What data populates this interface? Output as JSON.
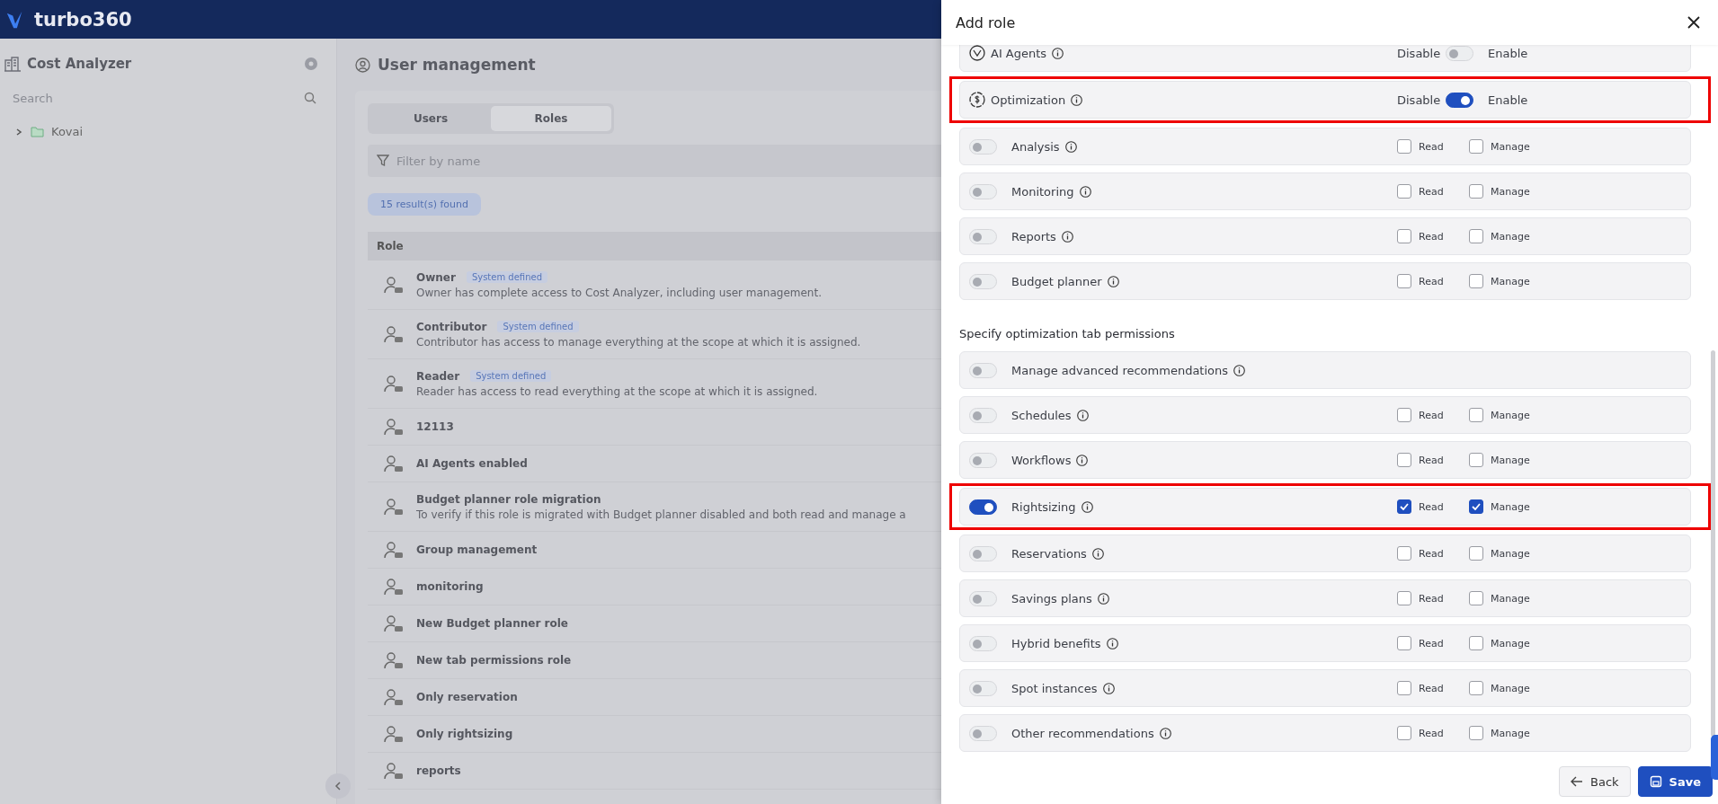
{
  "app": {
    "name": "turbo360"
  },
  "sidebar": {
    "title": "Cost Analyzer",
    "search": {
      "placeholder": "Search"
    },
    "tree": [
      {
        "label": "Kovai",
        "expanded": false
      }
    ]
  },
  "main": {
    "title": "User management",
    "tabs": [
      {
        "label": "Users",
        "selected": false
      },
      {
        "label": "Roles",
        "selected": true
      }
    ],
    "filter": {
      "placeholder": "Filter by name"
    },
    "result_count": "15 result(s) found",
    "table": {
      "columns": [
        "Role"
      ],
      "rows": [
        {
          "name": "Owner",
          "badge": "System defined",
          "description": "Owner has complete access to Cost Analyzer, including user management."
        },
        {
          "name": "Contributor",
          "badge": "System defined",
          "description": "Contributor has access to manage everything at the scope at which it is assigned."
        },
        {
          "name": "Reader",
          "badge": "System defined",
          "description": "Reader has access to read everything at the scope at which it is assigned."
        },
        {
          "name": "12113"
        },
        {
          "name": "AI Agents enabled"
        },
        {
          "name": "Budget planner role migration",
          "description": "To verify if this role is migrated with Budget planner disabled and both read and manage a"
        },
        {
          "name": "Group management"
        },
        {
          "name": "monitoring"
        },
        {
          "name": "New Budget planner role"
        },
        {
          "name": "New tab permissions role"
        },
        {
          "name": "Only reservation"
        },
        {
          "name": "Only rightsizing"
        },
        {
          "name": "reports"
        }
      ]
    }
  },
  "drawer": {
    "title": "Add role",
    "rows": [
      {
        "kind": "feature",
        "label": "AI Agents",
        "off_label": "Disable",
        "on_label": "Enable",
        "on": false,
        "highlighted": false
      },
      {
        "kind": "feature",
        "label": "Optimization",
        "off_label": "Disable",
        "on_label": "Enable",
        "on": true,
        "highlighted": true
      },
      {
        "kind": "permission",
        "label": "Analysis",
        "on": false,
        "read": {
          "label": "Read",
          "checked": false
        },
        "manage": {
          "label": "Manage",
          "checked": false
        },
        "highlighted": false
      },
      {
        "kind": "permission",
        "label": "Monitoring",
        "on": false,
        "read": {
          "label": "Read",
          "checked": false
        },
        "manage": {
          "label": "Manage",
          "checked": false
        },
        "highlighted": false
      },
      {
        "kind": "permission",
        "label": "Reports",
        "on": false,
        "read": {
          "label": "Read",
          "checked": false
        },
        "manage": {
          "label": "Manage",
          "checked": false
        },
        "highlighted": false
      },
      {
        "kind": "permission",
        "label": "Budget planner",
        "on": false,
        "read": {
          "label": "Read",
          "checked": false
        },
        "manage": {
          "label": "Manage",
          "checked": false
        },
        "highlighted": false
      }
    ],
    "section_title": "Specify optimization tab permissions",
    "tab_rows": [
      {
        "kind": "permission",
        "label": "Manage advanced recommendations",
        "on": false,
        "highlighted": false
      },
      {
        "kind": "permission",
        "label": "Schedules",
        "on": false,
        "read": {
          "label": "Read",
          "checked": false
        },
        "manage": {
          "label": "Manage",
          "checked": false
        },
        "highlighted": false
      },
      {
        "kind": "permission",
        "label": "Workflows",
        "on": false,
        "read": {
          "label": "Read",
          "checked": false
        },
        "manage": {
          "label": "Manage",
          "checked": false
        },
        "highlighted": false
      },
      {
        "kind": "permission",
        "label": "Rightsizing",
        "on": true,
        "read": {
          "label": "Read",
          "checked": true
        },
        "manage": {
          "label": "Manage",
          "checked": true
        },
        "highlighted": true
      },
      {
        "kind": "permission",
        "label": "Reservations",
        "on": false,
        "read": {
          "label": "Read",
          "checked": false
        },
        "manage": {
          "label": "Manage",
          "checked": false
        },
        "highlighted": false
      },
      {
        "kind": "permission",
        "label": "Savings plans",
        "on": false,
        "read": {
          "label": "Read",
          "checked": false
        },
        "manage": {
          "label": "Manage",
          "checked": false
        },
        "highlighted": false
      },
      {
        "kind": "permission",
        "label": "Hybrid benefits",
        "on": false,
        "read": {
          "label": "Read",
          "checked": false
        },
        "manage": {
          "label": "Manage",
          "checked": false
        },
        "highlighted": false
      },
      {
        "kind": "permission",
        "label": "Spot instances",
        "on": false,
        "read": {
          "label": "Read",
          "checked": false
        },
        "manage": {
          "label": "Manage",
          "checked": false
        },
        "highlighted": false
      },
      {
        "kind": "permission",
        "label": "Other recommendations",
        "on": false,
        "read": {
          "label": "Read",
          "checked": false
        },
        "manage": {
          "label": "Manage",
          "checked": false
        },
        "highlighted": false
      }
    ],
    "buttons": [
      {
        "label": "Back",
        "kind": "secondary"
      },
      {
        "label": "Save",
        "kind": "primary"
      }
    ]
  }
}
